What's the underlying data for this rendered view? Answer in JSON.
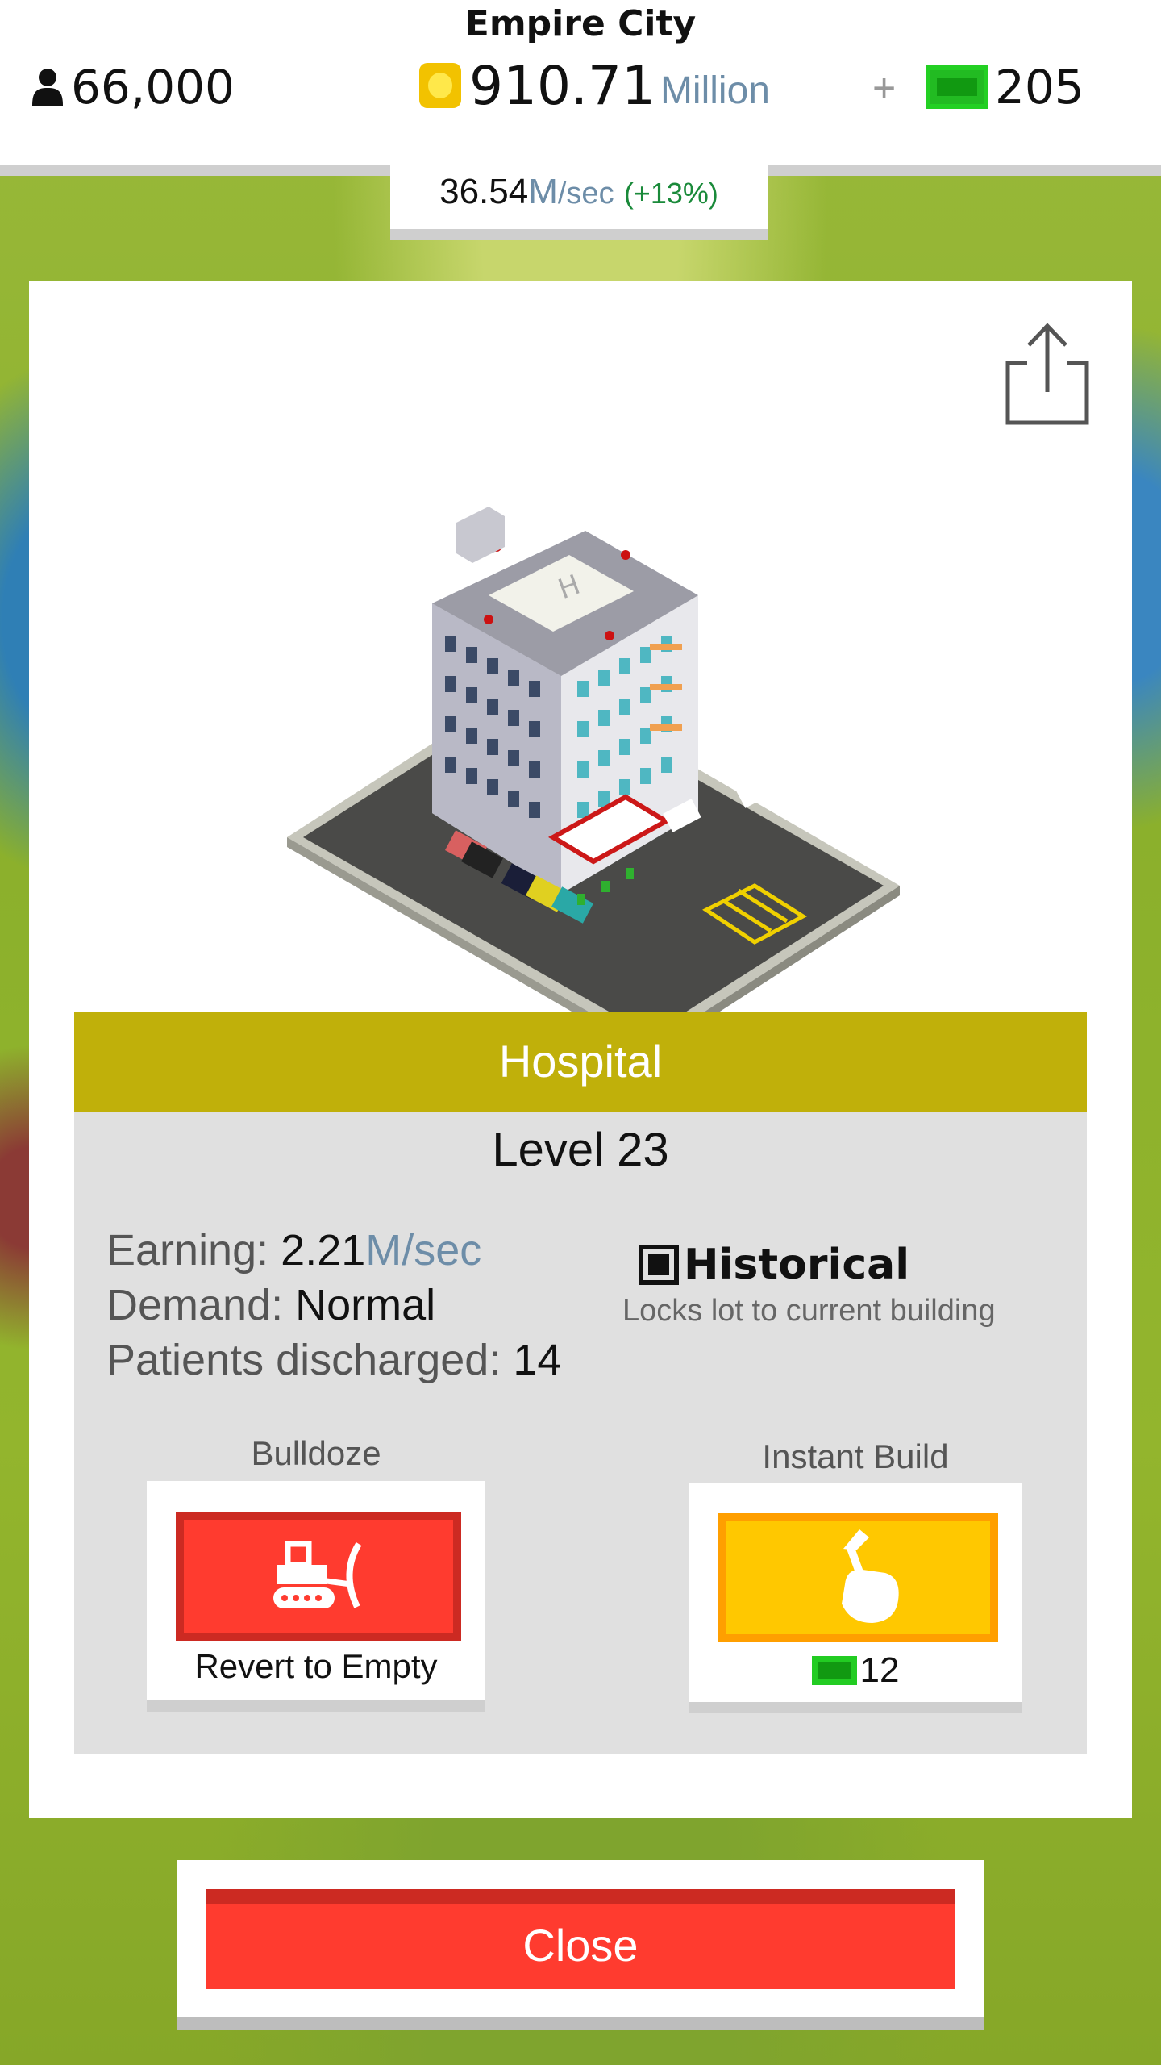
{
  "header": {
    "city_name": "Empire City",
    "population": "66,000",
    "coins_value": "910.71",
    "coins_unit": "Million",
    "plus_label": "+",
    "cash": "205",
    "rate_value": "36.54",
    "rate_unit": "M",
    "rate_suffix": "/sec",
    "rate_bonus": "(+13%)"
  },
  "building": {
    "name": "Hospital",
    "level": "Level 23",
    "earning_label": "Earning:",
    "earning_value": "2.21",
    "earning_unit": "M/sec",
    "demand_label": "Demand:",
    "demand_value": "Normal",
    "stat_label": "Patients discharged:",
    "stat_value": "14"
  },
  "historical": {
    "label": "Historical",
    "description": "Locks lot to current building"
  },
  "actions": {
    "bulldoze_label": "Bulldoze",
    "bulldoze_button": "Revert to Empty",
    "instant_label": "Instant Build",
    "instant_cost": "12"
  },
  "close_label": "Close",
  "icons": [
    "person-icon",
    "coin-icon",
    "cash-icon",
    "share-icon",
    "bulldozer-icon",
    "hammer-hand-icon",
    "checkbox-icon"
  ],
  "colors": {
    "title_bar": "#c0b00a",
    "bulldoze": "#ff3b2f",
    "instant": "#ffc800",
    "close": "#ff3b2f",
    "cash": "#22cc22"
  }
}
